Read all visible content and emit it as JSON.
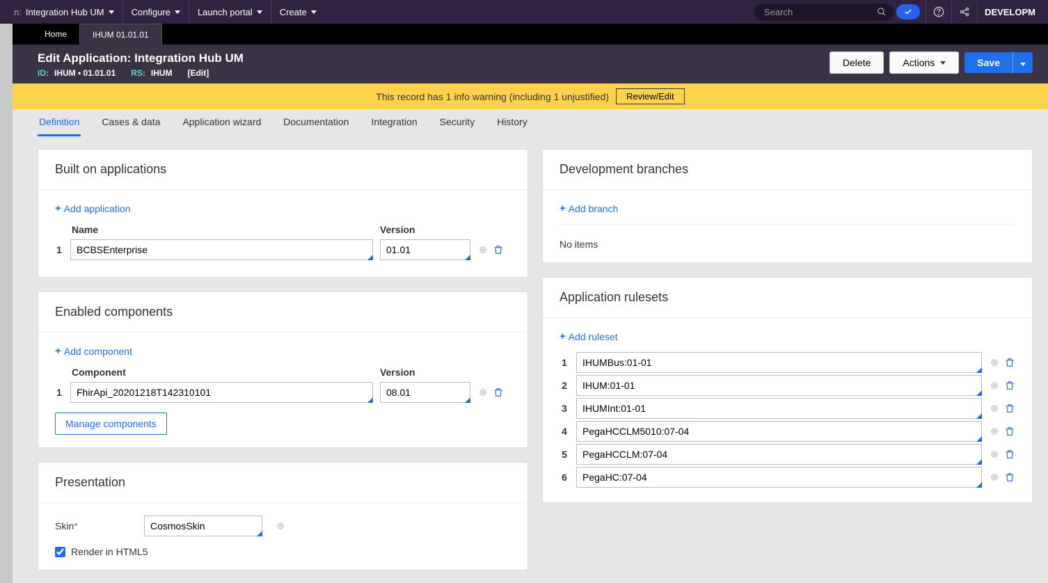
{
  "topbar": {
    "app_name": "Integration Hub UM",
    "menu": [
      "Configure",
      "Launch portal",
      "Create"
    ],
    "search_placeholder": "Search",
    "env": "DEVELOPM"
  },
  "tabs": [
    {
      "label": "Home",
      "active": false
    },
    {
      "label": "IHUM 01.01.01",
      "active": true
    }
  ],
  "header": {
    "title": "Edit Application: Integration Hub UM",
    "id_label": "ID:",
    "id_value": "IHUM • 01.01.01",
    "rs_label": "RS:",
    "rs_value": "IHUM",
    "edit_link": "[Edit]",
    "delete_btn": "Delete",
    "actions_btn": "Actions",
    "save_btn": "Save"
  },
  "notice": {
    "text": "This record has 1 info warning (including 1 unjustified)",
    "btn": "Review/Edit"
  },
  "subtabs": [
    "Definition",
    "Cases & data",
    "Application wizard",
    "Documentation",
    "Integration",
    "Security",
    "History"
  ],
  "built_on": {
    "title": "Built on applications",
    "add": "Add application",
    "head_name": "Name",
    "head_ver": "Version",
    "rows": [
      {
        "num": "1",
        "name": "BCBSEnterprise",
        "ver": "01.01"
      }
    ]
  },
  "components": {
    "title": "Enabled components",
    "add": "Add component",
    "head_name": "Component",
    "head_ver": "Version",
    "rows": [
      {
        "num": "1",
        "name": "FhirApi_20201218T142310101",
        "ver": "08.01"
      }
    ],
    "manage_btn": "Manage components"
  },
  "presentation": {
    "title": "Presentation",
    "skin_label": "Skin",
    "skin_value": "CosmosSkin",
    "render_label": "Render in HTML5",
    "render_checked": true
  },
  "branches": {
    "title": "Development branches",
    "add": "Add branch",
    "no_items": "No items"
  },
  "rulesets": {
    "title": "Application rulesets",
    "add": "Add ruleset",
    "rows": [
      {
        "num": "1",
        "name": "IHUMBus:01-01"
      },
      {
        "num": "2",
        "name": "IHUM:01-01"
      },
      {
        "num": "3",
        "name": "IHUMInt:01-01"
      },
      {
        "num": "4",
        "name": "PegaHCCLM5010:07-04"
      },
      {
        "num": "5",
        "name": "PegaHCCLM:07-04"
      },
      {
        "num": "6",
        "name": "PegaHC:07-04"
      }
    ]
  }
}
